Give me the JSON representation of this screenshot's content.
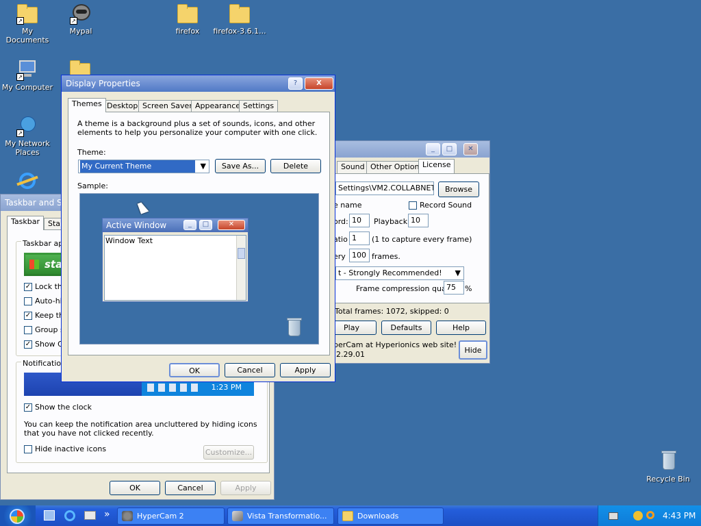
{
  "desktop": {
    "icons": [
      {
        "label": "My\nDocuments"
      },
      {
        "label": "Mypal"
      },
      {
        "label": "firefox"
      },
      {
        "label": "firefox-3.6.1..."
      },
      {
        "label": "My Computer"
      },
      {
        "label": "My Network\nPlaces"
      },
      {
        "label": "Recycle Bin"
      }
    ]
  },
  "display_properties": {
    "title": "Display Properties",
    "help_btn": "?",
    "close_btn": "X",
    "tabs": [
      "Themes",
      "Desktop",
      "Screen Saver",
      "Appearance",
      "Settings"
    ],
    "description": "A theme is a background plus a set of sounds, icons, and other elements to help you personalize your computer with one click.",
    "theme_label": "Theme:",
    "theme_value": "My Current Theme",
    "save_as": "Save As...",
    "delete": "Delete",
    "sample_label": "Sample:",
    "sample_window_title": "Active Window",
    "sample_window_text": "Window Text",
    "ok": "OK",
    "cancel": "Cancel",
    "apply": "Apply"
  },
  "hypercam": {
    "tabs": [
      "Sound",
      "Other Options",
      "License"
    ],
    "path_value": "Settings\\VM2.COLLABNET\\",
    "browse": "Browse",
    "name_label": "e name",
    "record_sound": "Record Sound",
    "record_label": "ord:",
    "record_value": "10",
    "playback_label": "Playback:",
    "playback_value": "10",
    "ratio_label": "atio",
    "ratio_value": "1",
    "ratio_hint": "(1 to capture every frame)",
    "every_label": "ery",
    "every_value": "100",
    "frames_label": "frames.",
    "compression_value": "t - Strongly Recommended!",
    "quality_label": "Frame compression quality",
    "quality_value": "75",
    "percent": "%",
    "frames_info": "Total frames: 1072, skipped: 0",
    "play": "Play",
    "defaults": "Defaults",
    "help": "Help",
    "site_text_1": "perCam at Hyperionics web site! Click",
    "site_text_2": "2.29.01",
    "hide": "Hide"
  },
  "taskbar_props": {
    "title": "Taskbar and Sta",
    "tabs": [
      "Taskbar",
      "Start"
    ],
    "appearance_group": "Taskbar app",
    "start_text": "sta",
    "options": [
      {
        "label": "Lock the",
        "checked": true
      },
      {
        "label": "Auto-hid",
        "checked": false
      },
      {
        "label": "Keep the",
        "checked": true
      },
      {
        "label": "Group si",
        "checked": false
      },
      {
        "label": "Show Q",
        "checked": true
      }
    ],
    "notification_group": "Notification a",
    "preview_time": "1:23 PM",
    "show_clock": "Show the clock",
    "notif_text": "You can keep the notification area uncluttered by hiding icons that you have not clicked recently.",
    "hide_inactive": "Hide inactive icons",
    "customize": "Customize...",
    "ok": "OK",
    "cancel": "Cancel",
    "apply": "Apply"
  },
  "taskbar": {
    "quicklaunch_more": "»",
    "buttons": [
      {
        "label": "HyperCam 2"
      },
      {
        "label": "Vista Transformatio..."
      },
      {
        "label": "Downloads"
      }
    ],
    "clock": "4:43 PM"
  },
  "colors": {
    "desktop": "#3a6ea5",
    "title_active": "#4a6fb8",
    "taskbar": "#245edb"
  }
}
